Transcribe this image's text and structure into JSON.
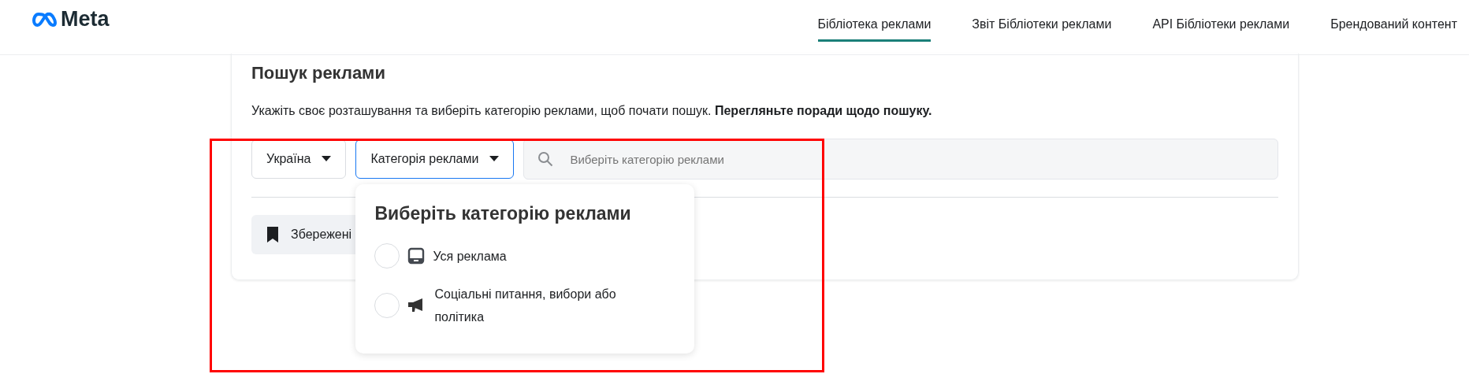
{
  "header": {
    "logo": "Meta",
    "nav": [
      {
        "label": "Бібліотека реклами",
        "selected": true
      },
      {
        "label": "Звіт Бібліотеки реклами",
        "selected": false
      },
      {
        "label": "API Бібліотеки реклами",
        "selected": false
      },
      {
        "label": "Брендований контент",
        "selected": false
      }
    ]
  },
  "search": {
    "title": "Пошук реклами",
    "description": "Укажіть своє розташування та виберіть категорію реклами, щоб почати пошук. **Перегляньте поради щодо пошуку.**",
    "country": "Україна",
    "category": "Категорія реклами",
    "placeholder": "Виберіть категорію реклами",
    "saved": "Збережені"
  },
  "dropdown": {
    "title": "Виберіть категорію реклами",
    "options": [
      {
        "label": "Уся реклама",
        "kind": "all",
        "selected": false
      },
      {
        "label": "Соціальні питання, вибори або політика",
        "kind": "political",
        "selected": false
      }
    ]
  }
}
